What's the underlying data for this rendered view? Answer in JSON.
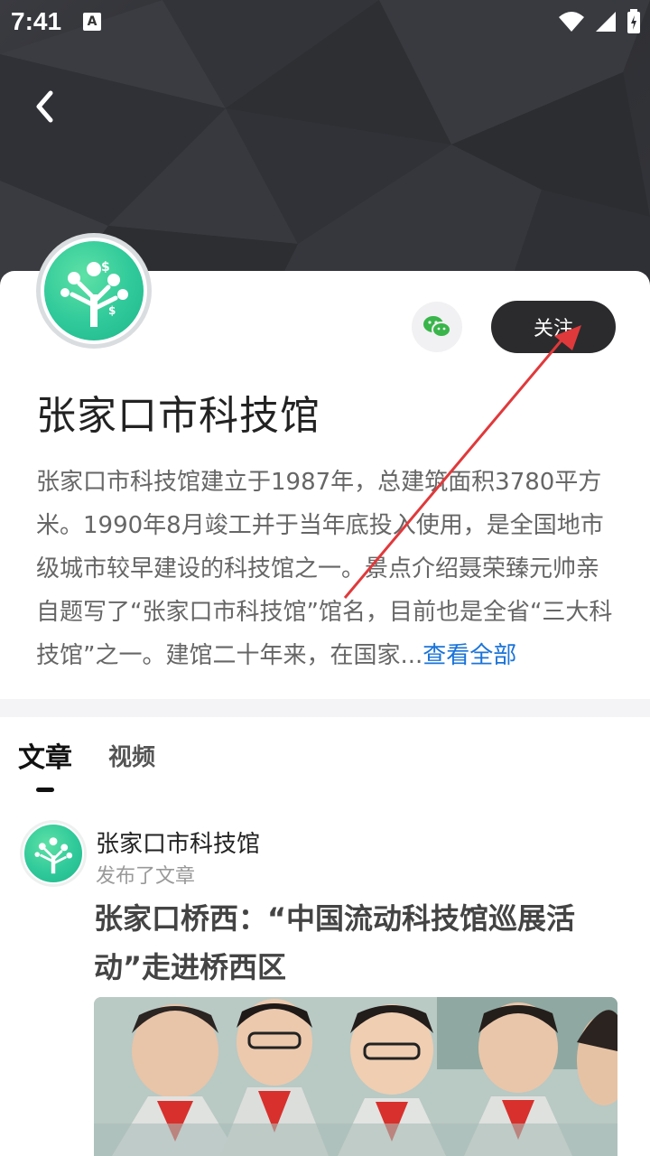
{
  "status_bar": {
    "time": "7:41",
    "notification_icon_letter": "A"
  },
  "header": {
    "back_icon": "chevron-left-icon"
  },
  "profile": {
    "name": "张家口市科技馆",
    "follow_label": "关注",
    "wechat_icon": "wechat-icon",
    "intro_text": "张家口市科技馆建立于1987年，总建筑面积3780平方米。1990年8月竣工并于当年底投入使用，是全国地市级城市较早建设的科技馆之一。景点介绍聂荣臻元帅亲自题写了“张家口市科技馆”馆名，目前也是全省“三大科技馆”之一。建馆二十年来，在国家...",
    "more_link": "查看全部"
  },
  "tabs": [
    {
      "label": "文章",
      "active": true
    },
    {
      "label": "视频",
      "active": false
    }
  ],
  "post": {
    "author": "张家口市科技馆",
    "action": "发布了文章",
    "title": "张家口桥西：“中国流动科技馆巡展活动”走进桥西区"
  },
  "colors": {
    "accent_link": "#1a73d9",
    "follow_bg": "#2b2b2d",
    "annotation_arrow": "#e0393b",
    "logo_green": "#2fc99a"
  }
}
